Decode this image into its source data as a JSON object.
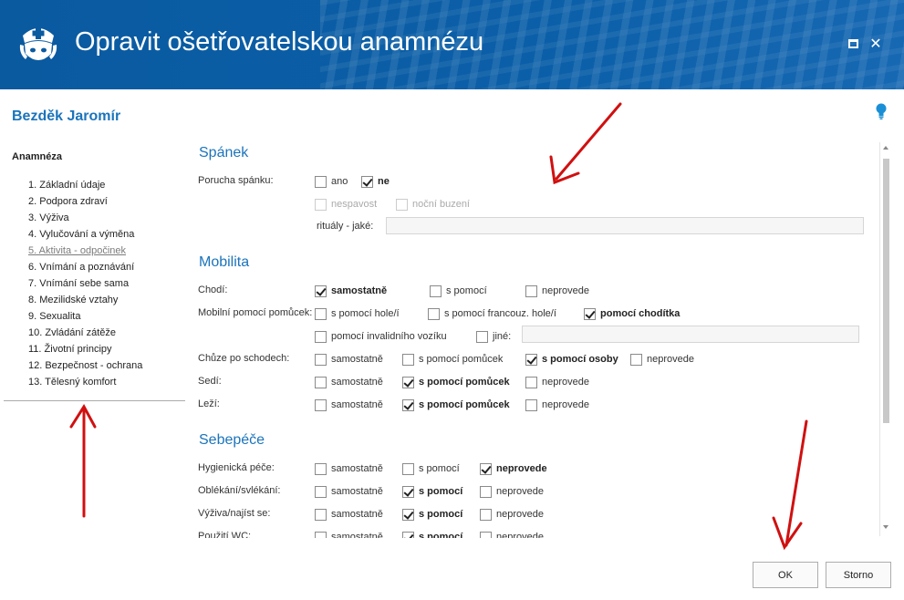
{
  "window": {
    "title": "Opravit ošetřovatelskou anamnézu",
    "maximize_icon": "maximize-icon",
    "close_label": "✕"
  },
  "patient": {
    "name": "Bezděk Jaromír"
  },
  "nav": {
    "title": "Anamnéza",
    "items": [
      "1. Základní údaje",
      "2. Podpora zdraví",
      "3. Výživa",
      "4. Vylučování a výměna",
      "5. Aktivita - odpočinek",
      "6. Vnímání a poznávání",
      "7. Vnímání sebe sama",
      "8. Mezilidské vztahy",
      "9. Sexualita",
      "10. Zvládání zátěže",
      "11. Životní principy",
      "12. Bezpečnost - ochrana",
      "13. Tělesný komfort"
    ],
    "active_index": 4
  },
  "sections": {
    "spanek": {
      "title": "Spánek",
      "porucha_label": "Porucha spánku:",
      "ano": "ano",
      "ne": "ne",
      "nespavost": "nespavost",
      "nocni_buzeni": "noční buzení",
      "ritualy_label": "rituály - jaké:"
    },
    "mobilita": {
      "title": "Mobilita",
      "chodi_label": "Chodí:",
      "samostatne": "samostatně",
      "s_pomoci": "s pomocí",
      "neprovede": "neprovede",
      "pomucky_label": "Mobilní pomocí pomůcek:",
      "hole": "s pomocí hole/í",
      "francouz": "s pomocí francouz. hole/í",
      "choditka": "pomocí chodítka",
      "invalidni": "pomocí invalidního vozíku",
      "jine": "jiné:",
      "schody_label": "Chůze po schodech:",
      "s_pomoci_pomucek": "s pomocí pomůcek",
      "s_pomoci_osoby": "s pomocí osoby",
      "sedi_label": "Sedí:",
      "lezi_label": "Leží:"
    },
    "sebepece": {
      "title": "Sebepéče",
      "hygiena_label": "Hygienická péče:",
      "oblekani_label": "Oblékání/svlékání:",
      "vyziva_label": "Výživa/najíst se:",
      "wc_label": "Použití WC:",
      "samostatne": "samostatně",
      "s_pomoci": "s pomocí",
      "neprovede": "neprovede"
    }
  },
  "buttons": {
    "ok": "OK",
    "cancel": "Storno"
  },
  "colors": {
    "titlebar": "#0a5aa0",
    "accent": "#1b74bb",
    "arrow": "#d01010"
  }
}
